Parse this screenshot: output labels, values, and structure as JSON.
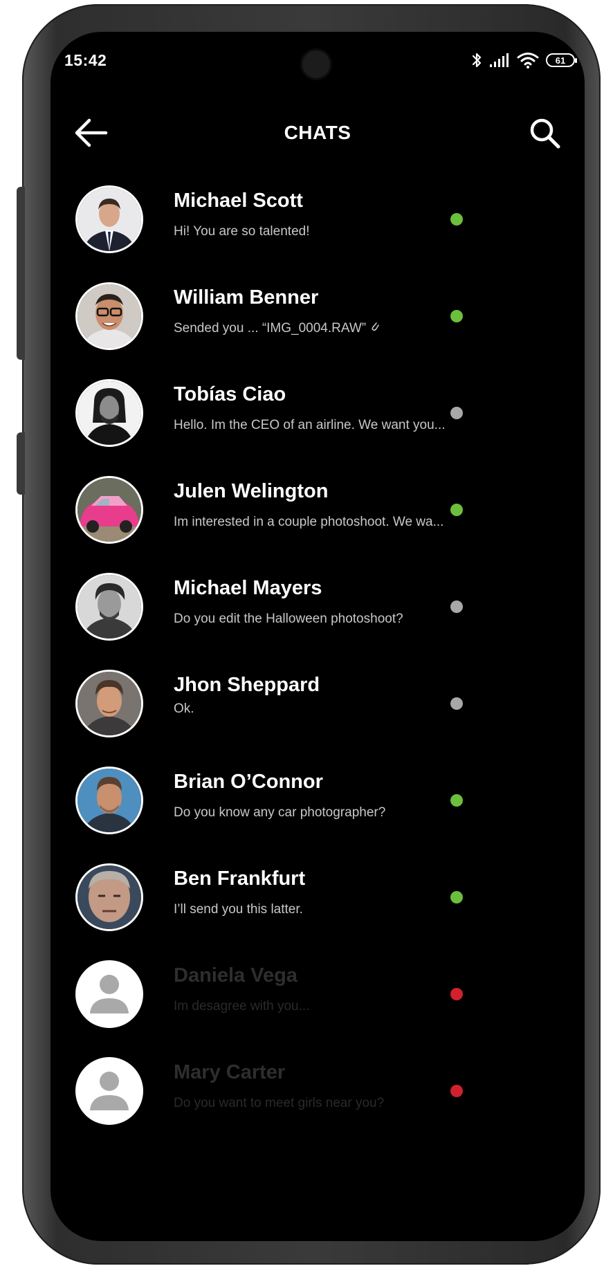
{
  "status_bar": {
    "time": "15:42",
    "battery": "61"
  },
  "header": {
    "title": "CHATS"
  },
  "chats": [
    {
      "name": "Michael Scott",
      "message": "Hi! You are so talented!",
      "status": "online"
    },
    {
      "name": "William Benner",
      "message": "Sended you ... “IMG_0004.RAW”",
      "status": "online",
      "attachment": true
    },
    {
      "name": "Tobías Ciao",
      "message": "Hello. Im the CEO of an airline. We want you...",
      "status": "away"
    },
    {
      "name": "Julen Welington",
      "message": "Im interested in a couple photoshoot. We wa...",
      "status": "online"
    },
    {
      "name": "Michael Mayers",
      "message": "Do you edit the Halloween photoshoot?",
      "status": "away"
    },
    {
      "name": "Jhon Sheppard",
      "message": "Ok.",
      "status": "away"
    },
    {
      "name": "Brian O’Connor",
      "message": "Do you know any car photographer?",
      "status": "online"
    },
    {
      "name": "Ben Frankfurt",
      "message": "I’ll send you this latter.",
      "status": "online"
    },
    {
      "name": "Daniela Vega",
      "message": "Im desagree with you...",
      "status": "blocked"
    },
    {
      "name": "Mary Carter",
      "message": "Do you want to meet girls near you?",
      "status": "blocked"
    }
  ],
  "colors": {
    "online": "#6cbf3c",
    "away": "#a8a8a8",
    "blocked": "#d1212f"
  }
}
